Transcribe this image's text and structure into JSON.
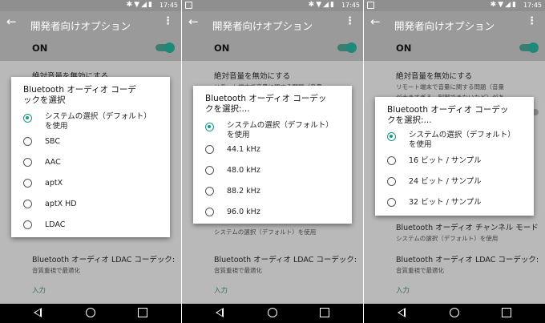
{
  "screens": [
    {
      "status_time": "17:45",
      "app_title": "開発者向けオプション",
      "on_label": "ON",
      "bg_items": [
        {
          "title": "絶対音量を無効にする",
          "subtitle": ""
        },
        {
          "title": "Bluetooth オーディオ LDAC コーデック: 再...",
          "subtitle": "音質重視で最適化"
        }
      ],
      "section_label": "入力",
      "dialog": {
        "title_line1": "Bluetooth オーディオ コーデ",
        "title_line2": "ックを選択",
        "options": [
          {
            "label": "システムの選択（デフォルト）",
            "label2": "を使用",
            "selected": true
          },
          {
            "label": "SBC",
            "label2": "",
            "selected": false
          },
          {
            "label": "AAC",
            "label2": "",
            "selected": false
          },
          {
            "label": "aptX",
            "label2": "",
            "selected": false
          },
          {
            "label": "aptX HD",
            "label2": "",
            "selected": false
          },
          {
            "label": "LDAC",
            "label2": "",
            "selected": false
          }
        ]
      }
    },
    {
      "status_time": "17:45",
      "app_title": "開発者向けオプション",
      "on_label": "ON",
      "bg_items": [
        {
          "title": "絶対音量を無効にする",
          "subtitle": "リモート端末で音量に関する問題（音量"
        },
        {
          "title": "",
          "subtitle": "システムの選択（デフォルト）を使用"
        },
        {
          "title": "Bluetooth オーディオ LDAC コーデック: 再...",
          "subtitle": "音質重視で最適化"
        }
      ],
      "section_label": "入力",
      "dialog": {
        "title_line1": "Bluetooth オーディオ コーデッ",
        "title_line2": "クを選択:...",
        "options": [
          {
            "label": "システムの選択（デフォルト）",
            "label2": "を使用",
            "selected": true
          },
          {
            "label": "44.1 kHz",
            "label2": "",
            "selected": false
          },
          {
            "label": "48.0 kHz",
            "label2": "",
            "selected": false
          },
          {
            "label": "88.2 kHz",
            "label2": "",
            "selected": false
          },
          {
            "label": "96.0 kHz",
            "label2": "",
            "selected": false
          }
        ]
      }
    },
    {
      "status_time": "17:45",
      "app_title": "開発者向けオプション",
      "on_label": "ON",
      "bg_items": [
        {
          "title": "絶対音量を無効にする",
          "subtitle": "リモート端末で音量に関する問題（音量"
        },
        {
          "title": "",
          "subtitle": "が大きすぎる、制御できないなど）があ"
        },
        {
          "title": "Bluetooth オーディオ チャンネル モード",
          "subtitle": "システムの選択（デフォルト）を使用"
        },
        {
          "title": "Bluetooth オーディオ LDAC コーデック: 再...",
          "subtitle": "音質重視で最適化"
        }
      ],
      "section_label": "入力",
      "dialog": {
        "title_line1": "Bluetooth オーディオ コーデッ",
        "title_line2": "クを選択:...",
        "options": [
          {
            "label": "システムの選択（デフォルト）",
            "label2": "を使用",
            "selected": true
          },
          {
            "label": "16 ビット / サンプル",
            "label2": "",
            "selected": false
          },
          {
            "label": "24 ビット / サンプル",
            "label2": "",
            "selected": false
          },
          {
            "label": "32 ビット / サンプル",
            "label2": "",
            "selected": false
          }
        ]
      }
    }
  ],
  "icons": {
    "back": "arrow-left-icon",
    "more": "more-vert-icon",
    "status": "bluetooth-wifi-signal-battery-icons",
    "nav_back": "nav-back-icon",
    "nav_home": "nav-home-icon",
    "nav_recent": "nav-recent-icon"
  },
  "colors": {
    "accent": "#159a86",
    "scrim": "#b9b9b9",
    "appbar": "#9a9a9a"
  }
}
